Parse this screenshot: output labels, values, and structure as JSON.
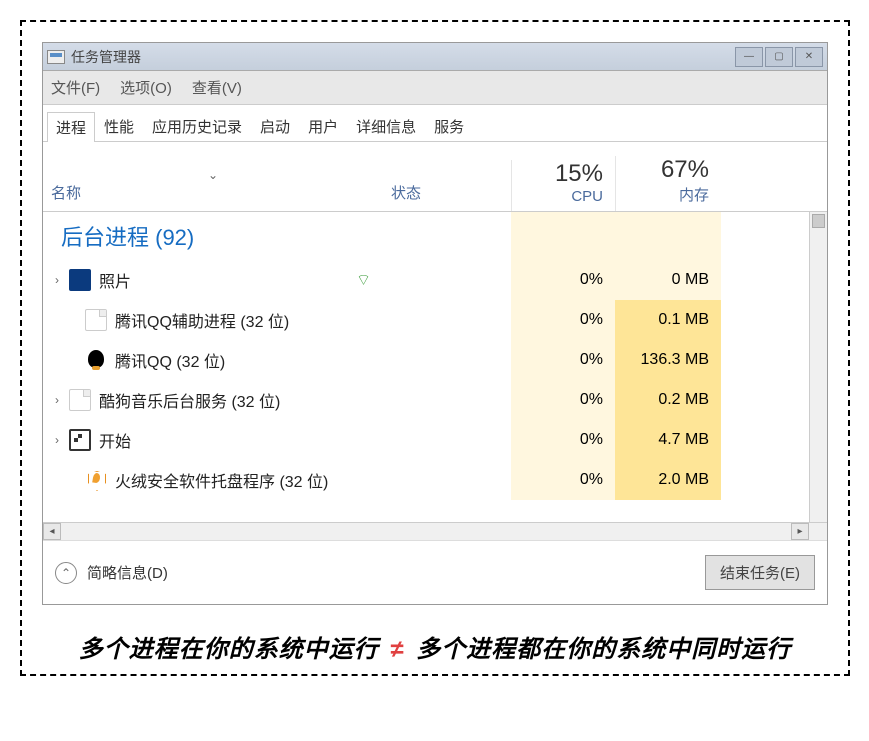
{
  "window": {
    "title": "任务管理器"
  },
  "menu": {
    "file": "文件(F)",
    "options": "选项(O)",
    "view": "查看(V)"
  },
  "tabs": {
    "processes": "进程",
    "performance": "性能",
    "history": "应用历史记录",
    "startup": "启动",
    "users": "用户",
    "details": "详细信息",
    "services": "服务"
  },
  "columns": {
    "name": "名称",
    "status": "状态",
    "cpu_pct": "15%",
    "cpu_label": "CPU",
    "mem_pct": "67%",
    "mem_label": "内存"
  },
  "group": {
    "label": "后台进程 (92)"
  },
  "rows": [
    {
      "expandable": true,
      "indent": false,
      "icon": "photo",
      "name": "照片",
      "leaf": true,
      "cpu": "0%",
      "mem": "0 MB",
      "mem_light": true
    },
    {
      "expandable": false,
      "indent": true,
      "icon": "doc",
      "name": "腾讯QQ辅助进程 (32 位)",
      "leaf": false,
      "cpu": "0%",
      "mem": "0.1 MB",
      "mem_light": false
    },
    {
      "expandable": false,
      "indent": true,
      "icon": "qq",
      "name": "腾讯QQ (32 位)",
      "leaf": false,
      "cpu": "0%",
      "mem": "136.3 MB",
      "mem_light": false
    },
    {
      "expandable": true,
      "indent": false,
      "icon": "doc",
      "name": "酷狗音乐后台服务 (32 位)",
      "leaf": false,
      "cpu": "0%",
      "mem": "0.2 MB",
      "mem_light": false
    },
    {
      "expandable": true,
      "indent": false,
      "icon": "start",
      "name": "开始",
      "leaf": false,
      "cpu": "0%",
      "mem": "4.7 MB",
      "mem_light": false
    },
    {
      "expandable": false,
      "indent": true,
      "icon": "shield",
      "name": "火绒安全软件托盘程序 (32 位)",
      "leaf": false,
      "cpu": "0%",
      "mem": "2.0 MB",
      "mem_light": false
    }
  ],
  "footer": {
    "brief": "简略信息(D)",
    "end_task": "结束任务(E)"
  },
  "caption": {
    "left": "多个进程在你的系统中运行",
    "neq": "≠",
    "right": "多个进程都在你的系统中同时运行"
  }
}
